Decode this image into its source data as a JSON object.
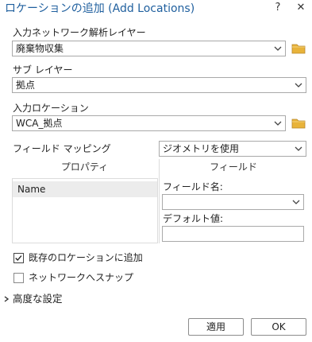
{
  "dialog": {
    "title": "ロケーションの追加 (Add Locations)",
    "help_glyph": "?",
    "close_glyph": "✕"
  },
  "input_network": {
    "label": "入力ネットワーク解析レイヤー",
    "value": "廃棄物収集"
  },
  "sublayer": {
    "label": "サブ レイヤー",
    "value": "拠点"
  },
  "input_locations": {
    "label": "入力ロケーション",
    "value": "WCA_拠点"
  },
  "field_mapping": {
    "label": "フィールド マッピング",
    "value": "ジオメトリを使用",
    "property_header": "プロパティ",
    "field_header": "フィールド",
    "property_rows": [
      "Name"
    ],
    "field_name_label": "フィールド名:",
    "field_name_value": "",
    "default_value_label": "デフォルト値:",
    "default_value": ""
  },
  "options": {
    "append_label": "既存のロケーションに追加",
    "append_checked": true,
    "snap_label": "ネットワークへスナップ",
    "snap_checked": false
  },
  "advanced": {
    "label": "高度な設定"
  },
  "buttons": {
    "apply": "適用",
    "ok": "OK"
  },
  "colors": {
    "title": "#1f5f9e",
    "folder": "#e8b33a",
    "panel_border": "#dcdcdc"
  }
}
